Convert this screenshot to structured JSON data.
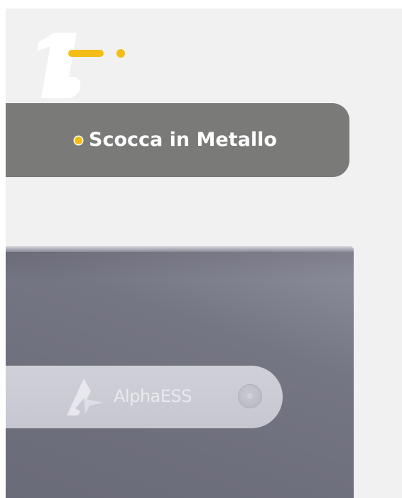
{
  "section": {
    "label": "Scocca in Metallo",
    "accent_color": "#f3bd16",
    "number_mark_icon": "number-1-icon"
  },
  "device": {
    "brand_name": "AlphaESS",
    "logo_icon": "alphaess-logo-icon",
    "button_icon": "power-button-icon",
    "body_color": "#737482",
    "strip_color": "#cbccd4"
  }
}
